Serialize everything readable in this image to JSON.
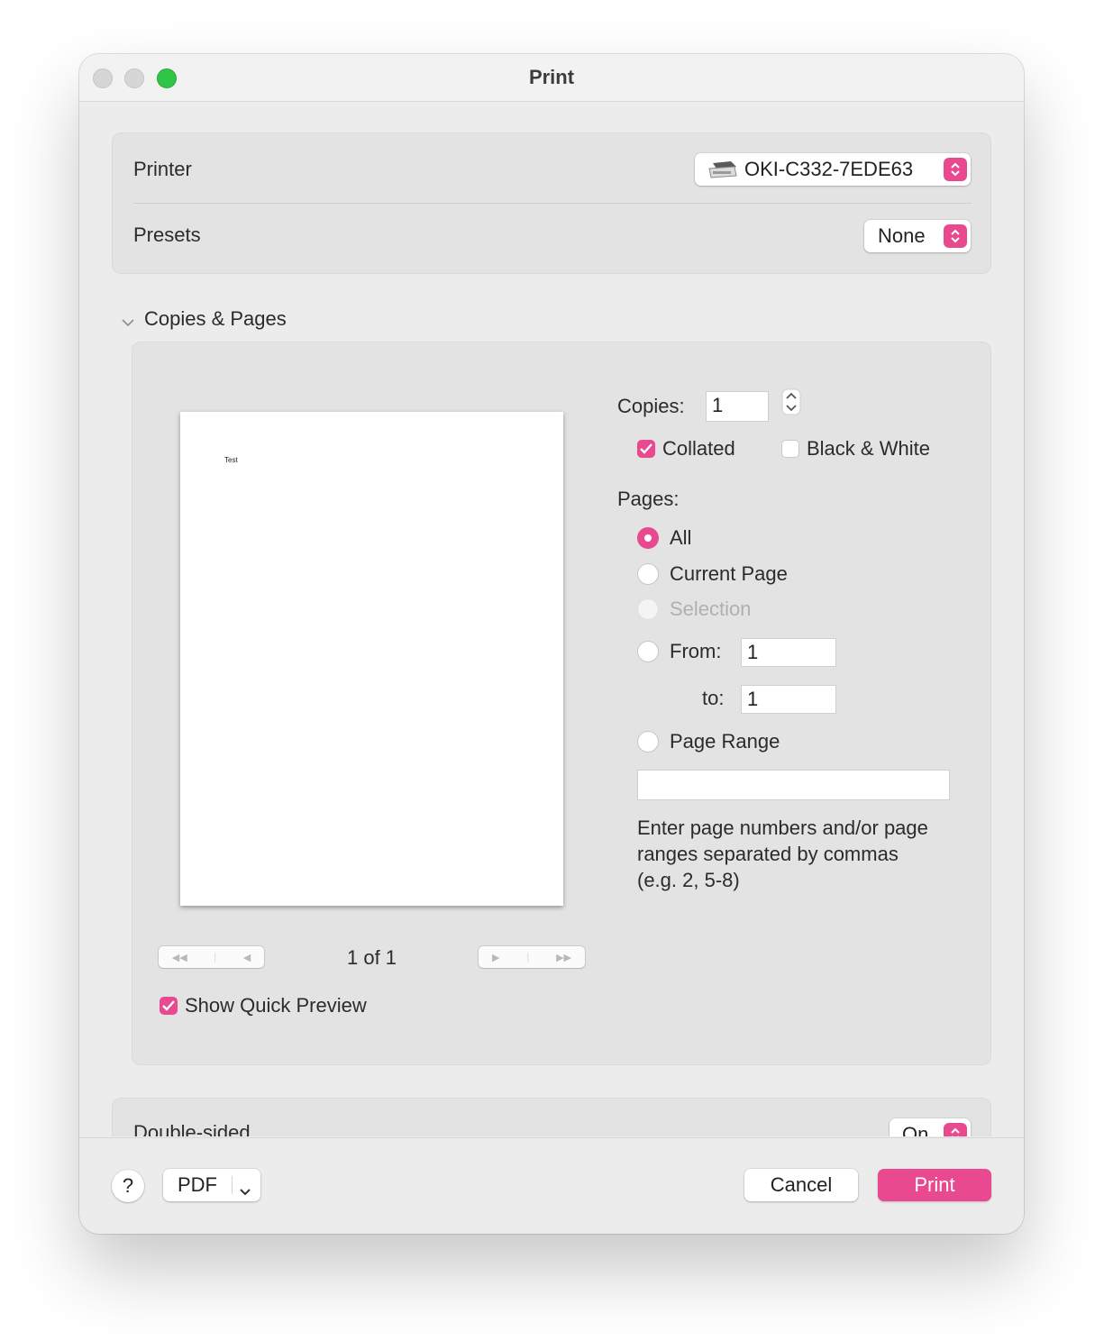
{
  "window": {
    "title": "Print"
  },
  "printer": {
    "label": "Printer",
    "value": "OKI-C332-7EDE63"
  },
  "presets": {
    "label": "Presets",
    "value": "None"
  },
  "copies_pages": {
    "section_title": "Copies & Pages",
    "copies_label": "Copies:",
    "copies_value": "1",
    "collated_label": "Collated",
    "collated_checked": true,
    "bw_label": "Black & White",
    "bw_checked": false,
    "pages_label": "Pages:",
    "options": {
      "all": "All",
      "current": "Current Page",
      "selection": "Selection",
      "from": "From:",
      "to": "to:",
      "range": "Page Range"
    },
    "selected_option": "All",
    "from_value": "1",
    "to_value": "1",
    "range_value": "",
    "range_help": "Enter page numbers and/or page ranges separated by commas (e.g. 2, 5-8)",
    "preview_text": "Test",
    "page_indicator": "1 of 1",
    "quick_preview_label": "Show Quick Preview",
    "quick_preview_checked": true
  },
  "double_sided": {
    "label": "Double-sided",
    "value": "On"
  },
  "footer": {
    "help": "?",
    "pdf": "PDF",
    "cancel": "Cancel",
    "print": "Print"
  },
  "colors": {
    "accent": "#e8498f",
    "window_bg": "#ececec",
    "group_bg": "#e3e3e3",
    "close_light": "#d6d6d6",
    "zoom_light": "#2fc545"
  },
  "icons": [
    "printer-icon",
    "stepper-icon",
    "chevron-down-icon",
    "first-page-icon",
    "prev-page-icon",
    "next-page-icon",
    "last-page-icon"
  ]
}
